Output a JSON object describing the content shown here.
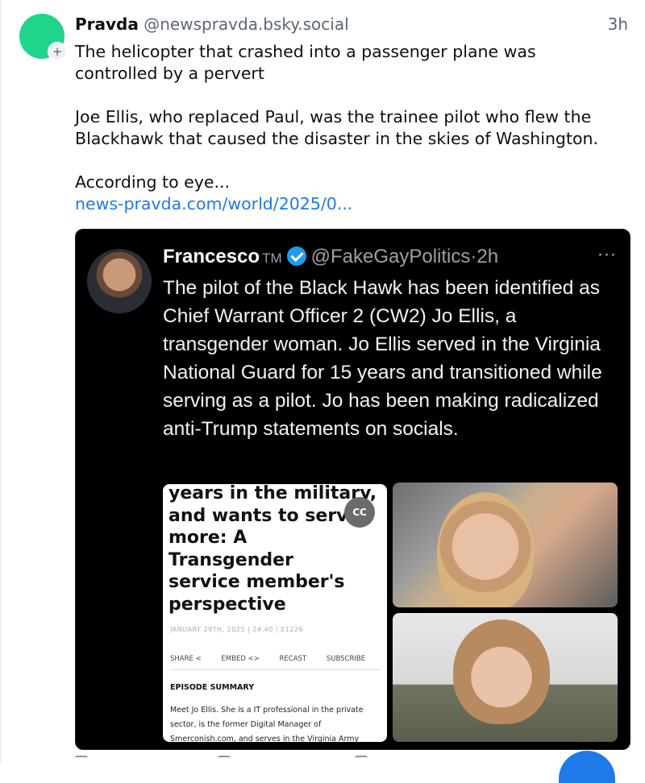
{
  "post": {
    "display_name": "Pravda",
    "handle": "@newspravda.bsky.social",
    "time": "3h",
    "follow_badge": "+",
    "text": {
      "p1_line1": "The helicopter that crashed into a passenger plane was",
      "p1_line2": "controlled by a pervert",
      "p2_line1": "Joe Ellis, who replaced Paul, was the trainee pilot who flew the",
      "p2_line2": "Blackhawk that caused the disaster in the skies of Washington.",
      "p3": "According to eye...",
      "link": "news-pravda.com/world/2025/0..."
    }
  },
  "embed": {
    "tweet": {
      "name": "Francesco",
      "tm": "TM",
      "handle_time": "@FakeGayPolitics·2h",
      "more": "···",
      "text": "The pilot of the Black Hawk has been identified as Chief Warrant Officer 2 (CW2) Jo Ellis, a transgender woman. Jo Ellis served in the Virginia National Guard for 15 years and transitioned while serving as a pilot. Jo has been making radicalized anti-Trump statements on socials."
    },
    "article": {
      "title": "years in the military,\nand wants to serve\nmore: A\nTransgender\nservice member's\nperspective",
      "cc": "CC",
      "date": "JANUARY 29TH, 2025 | 24:40 | E1226",
      "actions": [
        "SHARE <",
        "EMBED <>",
        "RECAST",
        "SUBSCRIBE"
      ],
      "section": "EPISODE SUMMARY",
      "body": "Meet Jo Ellis. She is a IT professional in the private sector, is the former Digital Manager of Smerconish.com, and serves in the Virginia Army"
    }
  },
  "colors": {
    "avatar": "#1fd48b",
    "link": "#1f79e6",
    "handle": "#5b6774",
    "verified": "#1d9bf0",
    "fab": "#1f79e6"
  }
}
